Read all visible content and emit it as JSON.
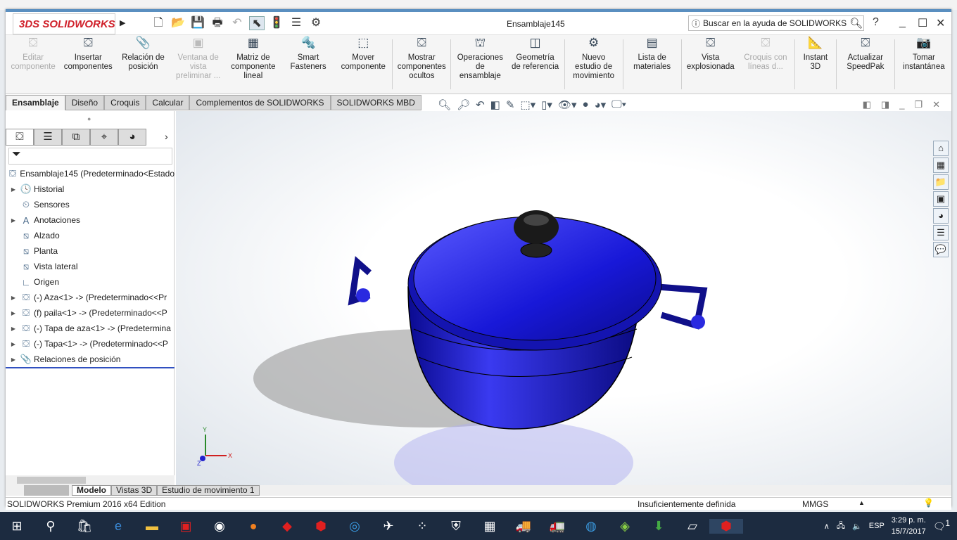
{
  "app": {
    "title": "Ensamblaje145",
    "logo": "SOLIDWORKS",
    "search_placeholder": "Buscar en la ayuda de SOLIDWORKS"
  },
  "ribbon": [
    {
      "label": "Editar componente",
      "icon": "edit-component",
      "disabled": true
    },
    {
      "label": "Insertar componentes",
      "icon": "insert-components"
    },
    {
      "label": "Relación de posición",
      "icon": "paperclip"
    },
    {
      "label": "Ventana de vista preliminar ...",
      "icon": "preview-window",
      "disabled": true
    },
    {
      "label": "Matriz de componente lineal",
      "icon": "linear-pattern"
    },
    {
      "label": "Smart Fasteners",
      "icon": "smart-fasteners"
    },
    {
      "label": "Mover componente",
      "icon": "move-component"
    },
    {
      "label": "Mostrar componentes ocultos",
      "icon": "show-hidden"
    },
    {
      "label": "Operaciones de ensamblaje",
      "icon": "assembly-features"
    },
    {
      "label": "Geometría de referencia",
      "icon": "reference-geometry"
    },
    {
      "label": "Nuevo estudio de movimiento",
      "icon": "motion-study"
    },
    {
      "label": "Lista de materiales",
      "icon": "bom"
    },
    {
      "label": "Vista explosionada",
      "icon": "exploded-view"
    },
    {
      "label": "Croquis con líneas d...",
      "icon": "explode-line-sketch",
      "disabled": true
    },
    {
      "label": "Instant 3D",
      "icon": "instant-3d"
    },
    {
      "label": "Actualizar SpeedPak",
      "icon": "speedpak"
    },
    {
      "label": "Tomar instantánea",
      "icon": "camera"
    }
  ],
  "tabs": [
    "Ensamblaje",
    "Diseño",
    "Croquis",
    "Calcular",
    "Complementos de SOLIDWORKS",
    "SOLIDWORKS MBD"
  ],
  "tree": {
    "root": "Ensamblaje145  (Predeterminado<Estado",
    "items": [
      {
        "label": "Historial",
        "expand": true
      },
      {
        "label": "Sensores",
        "expand": false
      },
      {
        "label": "Anotaciones",
        "expand": true
      },
      {
        "label": "Alzado",
        "expand": false
      },
      {
        "label": "Planta",
        "expand": false
      },
      {
        "label": "Vista lateral",
        "expand": false
      },
      {
        "label": "Origen",
        "expand": false
      },
      {
        "label": "(-) Aza<1> -> (Predeterminado<<Pr",
        "expand": true
      },
      {
        "label": "(f) paila<1> -> (Predeterminado<<P",
        "expand": true
      },
      {
        "label": "(-) Tapa de aza<1> -> (Predetermina",
        "expand": true
      },
      {
        "label": "(-) Tapa<1> -> (Predeterminado<<P",
        "expand": true
      },
      {
        "label": "Relaciones de posición",
        "expand": true
      }
    ]
  },
  "triad": {
    "x": "X",
    "y": "Y",
    "z": "Z"
  },
  "bottom_tabs": [
    "Modelo",
    "Vistas 3D",
    "Estudio de movimiento 1"
  ],
  "status": {
    "edition": "SOLIDWORKS Premium 2016 x64 Edition",
    "state": "Insuficientemente definida",
    "units": "MMGS"
  },
  "taskbar": {
    "lang": "ESP",
    "time": "3:29 p. m.",
    "date": "15/7/2017",
    "notifications": "1"
  },
  "colors": {
    "model": "#1a1ad8",
    "accent": "#5a8fc0"
  }
}
